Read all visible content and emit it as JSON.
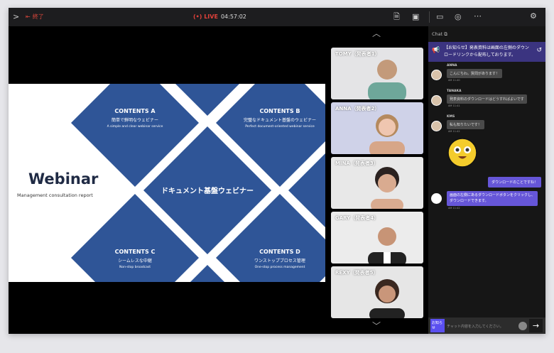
{
  "topbar": {
    "end_label": "終了",
    "live_label": "(•) LIVE",
    "timer": "04:57:02"
  },
  "slide": {
    "title": "Webinar",
    "subtitle": "Management consultation report",
    "center": "ドキュメント基盤ウェビナー",
    "cards": [
      {
        "heading": "CONTENTS A",
        "jp": "簡単で鮮明なウェビナー",
        "en": "A simple and clear webinar service"
      },
      {
        "heading": "CONTENTS B",
        "jp": "完璧なドキュメント基盤のウェビナー",
        "en": "Perfect document-oriented webinar service"
      },
      {
        "heading": "CONTENTS C",
        "jp": "シームレスな中継",
        "en": "Non-stop broadcast"
      },
      {
        "heading": "CONTENTS D",
        "jp": "ワンストップブロセス管理",
        "en": "One-stop process management"
      }
    ]
  },
  "presenters": [
    "TOMY（発表者1）",
    "ANNA（発表者2）",
    "MINA（発表者3）",
    "GARY（発表者4）",
    "REXY（発表者5）"
  ],
  "chat": {
    "title": "Chat ⧉",
    "announcement": "【お知らせ】発表資料は画面の左側のダウンロードリンクから配布しております。",
    "messages": [
      {
        "user": "ANNA",
        "text": "こんにちわ。質問があります！",
        "time": "AM 11:40"
      },
      {
        "user": "TANAKA",
        "text": "発表資料のダウンロードはどうすればよいです",
        "time": "AM 11:41"
      },
      {
        "user": "KMS",
        "text": "私も知りたいです！",
        "time": "AM 11:42"
      }
    ],
    "my_message": "ダウンロードのことですね！",
    "reply": "画面の左側にあるダウンロードボタンをクリックし、ダウンロードできます。",
    "reply_time": "AM 11:42",
    "notice_button": "お知らせ",
    "input_placeholder": "チャット内容を入力してください。"
  },
  "colors": {
    "accent": "#6656d8",
    "slide_blue": "#2f5597",
    "live": "#e0413a"
  }
}
